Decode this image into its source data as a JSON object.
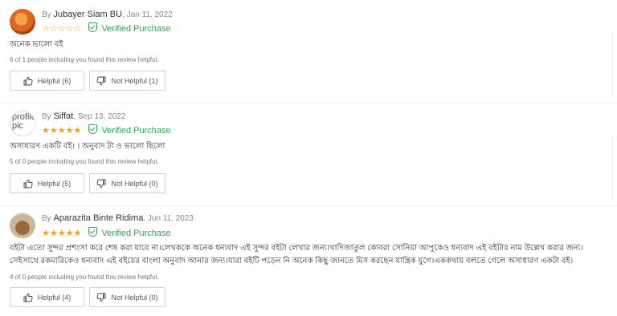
{
  "reviews": [
    {
      "by": "By ",
      "name": "Jubayer Siam BU",
      "date": ", Jan 11, 2022",
      "stars": [
        "☆",
        "☆",
        "☆",
        "☆",
        "☆"
      ],
      "verified": "Verified Purchase",
      "text": "অনেক ভালো বই",
      "helpful_note": "6 of 1 people including you found this review helpful.",
      "helpful_label": "Helpful (6)",
      "not_helpful_label": "Not Helpful (1)",
      "avatar_alt": ""
    },
    {
      "by": "By ",
      "name": "Siffat",
      "date": ", Sep 13, 2022",
      "stars": [
        "★",
        "★",
        "★",
        "★",
        "★"
      ],
      "verified": "Verified Purchase",
      "text": "অসাধারণ একটি বই। । অনুবাদ টা ও ভালো ছিলো",
      "helpful_note": "5 of 0 people including you found this review helpful.",
      "helpful_label": "Helpful (5)",
      "not_helpful_label": "Not Helpful (0)",
      "avatar_alt": "profile pic"
    },
    {
      "by": "By ",
      "name": "Aparazita Binte Ridima",
      "date": ", Jun 11, 2023",
      "stars": [
        "★",
        "★",
        "★",
        "★",
        "★"
      ],
      "verified": "Verified Purchase",
      "text": "বইটা এতো সুন্দর প্রশংসা করে শেষ করা যাবে না।লেখককে অনেক ধন্যবাদ এই সুন্দর বইটা লেখার জন্য।খাদিজাতুল কোবরা সোনিয়া আপুকেও ধন্যবাদ এই বইটার নাম উল্লেখ করার জন্য।সেইসাথে রকমারিকেও ধন্যবাদ এই বইয়ের বাংলা অনুবাদ আনার জন্য।যারা বইটি পড়েন নি অনেক কিছু জানতে মিস করছেন যান্ত্রিক যুগে।এককথায় বলতে গেলে অসাধারণ একটা বই।",
      "helpful_note": "4 of 0 people including you found this review helpful.",
      "helpful_label": "Helpful (4)",
      "not_helpful_label": "Not Helpful (0)",
      "avatar_alt": ""
    }
  ],
  "colors": {
    "star": "#f6a01a",
    "verified": "#2fa653"
  }
}
